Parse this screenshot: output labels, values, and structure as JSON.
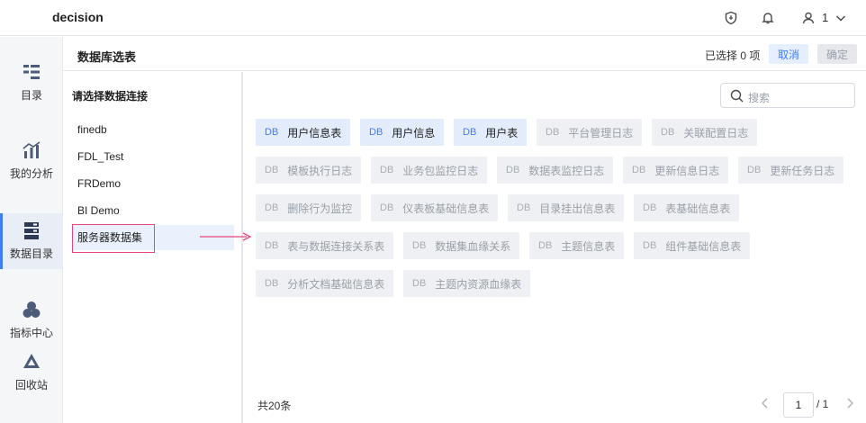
{
  "header": {
    "title": "decision",
    "user": "1"
  },
  "sidebar": {
    "items": [
      {
        "label": "目录",
        "icon": "catalog-icon"
      },
      {
        "label": "我的分析",
        "icon": "analysis-icon"
      },
      {
        "label": "数据目录",
        "icon": "data-catalog-icon",
        "active": true
      },
      {
        "label": "指标中心",
        "icon": "metrics-icon"
      },
      {
        "label": "回收站",
        "icon": "recycle-icon"
      }
    ]
  },
  "panel": {
    "title": "数据库选表",
    "selected_count": "已选择 0 项",
    "cancel_label": "取消",
    "ok_label": "确定"
  },
  "connections": {
    "title": "请选择数据连接",
    "items": [
      "finedb",
      "FDL_Test",
      "FRDemo",
      "BI Demo",
      "服务器数据集"
    ]
  },
  "search": {
    "placeholder": "搜索"
  },
  "tables": {
    "db_label": "DB",
    "items": [
      {
        "name": "用户信息表",
        "selected": true
      },
      {
        "name": "用户信息",
        "selected": true
      },
      {
        "name": "用户表",
        "selected": true
      },
      {
        "name": "平台管理日志",
        "selected": false
      },
      {
        "name": "关联配置日志",
        "selected": false
      },
      {
        "name": "模板执行日志",
        "selected": false
      },
      {
        "name": "业务包监控日志",
        "selected": false
      },
      {
        "name": "数据表监控日志",
        "selected": false
      },
      {
        "name": "更新信息日志",
        "selected": false
      },
      {
        "name": "更新任务日志",
        "selected": false
      },
      {
        "name": "删除行为监控",
        "selected": false
      },
      {
        "name": "仪表板基础信息表",
        "selected": false
      },
      {
        "name": "目录挂出信息表",
        "selected": false
      },
      {
        "name": "表基础信息表",
        "selected": false
      },
      {
        "name": "表与数据连接关系表",
        "selected": false
      },
      {
        "name": "数据集血缘关系",
        "selected": false
      },
      {
        "name": "主题信息表",
        "selected": false
      },
      {
        "name": "组件基础信息表",
        "selected": false
      },
      {
        "name": "分析文档基础信息表",
        "selected": false
      },
      {
        "name": "主题内资源血缘表",
        "selected": false
      }
    ]
  },
  "footer": {
    "total": "共20条",
    "page": "1",
    "page_total": "/ 1"
  },
  "colors": {
    "accent": "#3f7cf6",
    "highlight": "#e8457a"
  }
}
